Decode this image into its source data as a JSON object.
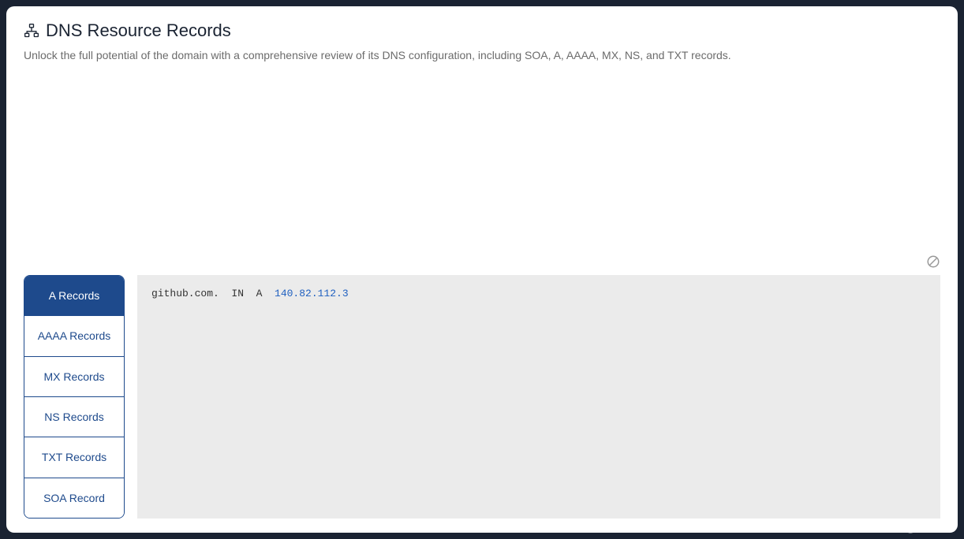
{
  "header": {
    "title": "DNS Resource Records",
    "subtitle": "Unlock the full potential of the domain with a comprehensive review of its DNS configuration, including SOA, A, AAAA, MX, NS, and TXT records."
  },
  "tabs": [
    {
      "label": "A Records",
      "active": true
    },
    {
      "label": "AAAA Records",
      "active": false
    },
    {
      "label": "MX Records",
      "active": false
    },
    {
      "label": "NS Records",
      "active": false
    },
    {
      "label": "TXT Records",
      "active": false
    },
    {
      "label": "SOA Record",
      "active": false
    }
  ],
  "record": {
    "prefix": "github.com.  IN  A  ",
    "ip": "140.82.112.3"
  },
  "watermark": "CSDN @aubun.cn"
}
